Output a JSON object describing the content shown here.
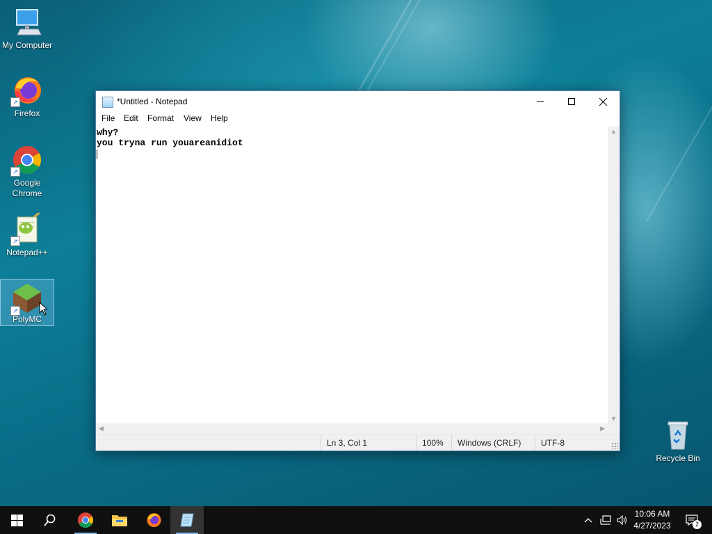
{
  "desktop": {
    "icons": [
      {
        "label": "My Computer",
        "icon": "computer-icon"
      },
      {
        "label": "Firefox",
        "icon": "firefox-icon"
      },
      {
        "label": "Google Chrome",
        "icon": "chrome-icon"
      },
      {
        "label": "Notepad++",
        "icon": "notepadpp-icon"
      },
      {
        "label": "PolyMC",
        "icon": "polymc-icon",
        "selected": true
      },
      {
        "label": "Recycle Bin",
        "icon": "recycle-bin-icon"
      }
    ]
  },
  "notepad": {
    "title": "*Untitled - Notepad",
    "menu": [
      "File",
      "Edit",
      "Format",
      "View",
      "Help"
    ],
    "lines": [
      "why?",
      "you tryna run youareanidiot"
    ],
    "status": {
      "position": "Ln 3, Col 1",
      "zoom": "100%",
      "line_ending": "Windows (CRLF)",
      "encoding": "UTF-8"
    }
  },
  "taskbar": {
    "pinned": [
      "windows-start-icon",
      "search-icon",
      "chrome-icon",
      "file-explorer-icon",
      "firefox-icon",
      "notepad-icon"
    ],
    "clock": {
      "time": "10:06 AM",
      "date": "4/27/2023"
    },
    "notification_count": "2"
  },
  "colors": {
    "taskbar": "#101010",
    "window_border": "#5a7fa8",
    "active_indicator": "#7db8e8"
  }
}
